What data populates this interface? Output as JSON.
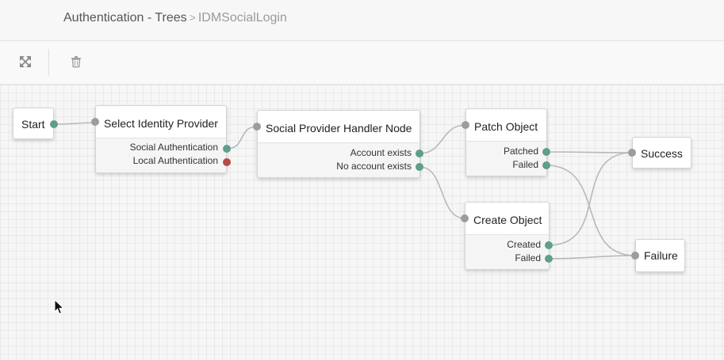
{
  "breadcrumb": {
    "parent": "Authentication - Trees",
    "separator": ">",
    "current": "IDMSocialLogin"
  },
  "toolbar": {
    "expand_icon": "expand-arrows-icon",
    "delete_icon": "trash-icon"
  },
  "colors": {
    "port_input": "#9c9c9c",
    "port_connected": "#5f9e8c",
    "port_unconnected": "#b94a48",
    "wire": "#b8b8b8"
  },
  "nodes": {
    "start": {
      "title": "Start"
    },
    "select_idp": {
      "title": "Select Identity Provider",
      "outcomes": [
        "Social Authentication",
        "Local Authentication"
      ]
    },
    "social_handler": {
      "title": "Social Provider Handler Node",
      "outcomes": [
        "Account exists",
        "No account exists"
      ]
    },
    "patch_object": {
      "title": "Patch Object",
      "outcomes": [
        "Patched",
        "Failed"
      ]
    },
    "create_object": {
      "title": "Create Object",
      "outcomes": [
        "Created",
        "Failed"
      ]
    },
    "success": {
      "title": "Success"
    },
    "failure": {
      "title": "Failure"
    }
  }
}
